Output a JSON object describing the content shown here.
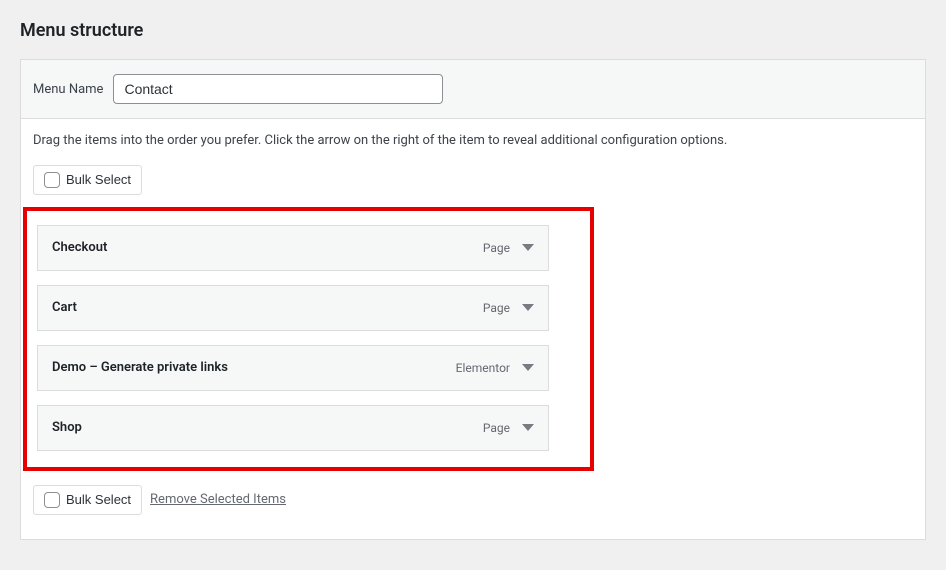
{
  "heading": "Menu structure",
  "menu_name": {
    "label": "Menu Name",
    "value": "Contact"
  },
  "instructions": "Drag the items into the order you prefer. Click the arrow on the right of the item to reveal additional configuration options.",
  "bulk_select_top": {
    "label": "Bulk Select"
  },
  "menu_items": [
    {
      "title": "Checkout",
      "type": "Page"
    },
    {
      "title": "Cart",
      "type": "Page"
    },
    {
      "title": "Demo – Generate private links",
      "type": "Elementor"
    },
    {
      "title": "Shop",
      "type": "Page"
    }
  ],
  "bulk_select_bottom": {
    "label": "Bulk Select"
  },
  "remove_selected": "Remove Selected Items"
}
